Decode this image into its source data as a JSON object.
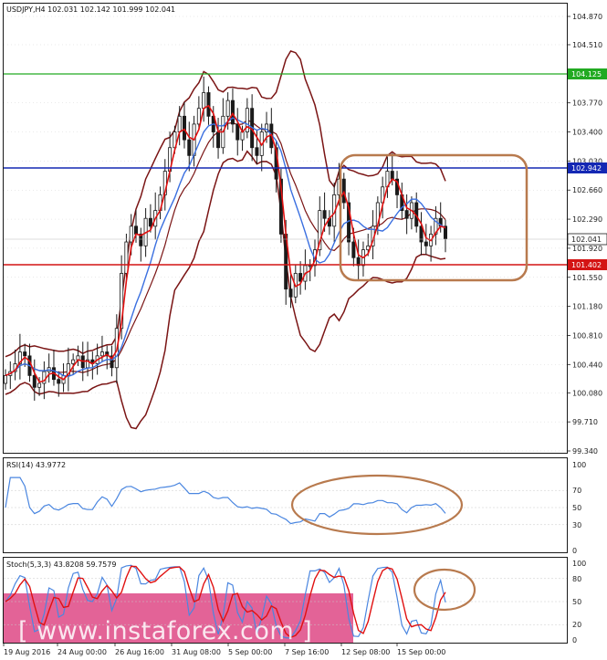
{
  "colors": {
    "frame": "#1a1a1a",
    "grid": "#c8c8c8",
    "bull": "#1a1a1a",
    "bear": "#1a1a1a",
    "boll": "#7a1414",
    "ma_fast": "#e01010",
    "ma_slow": "#3a6fe0",
    "line_green": "#22aa22",
    "line_blue": "#1428b4",
    "line_red": "#d41414",
    "annot": "#b87a4e",
    "rsi": "#4a86e0",
    "stoch_main": "#4a86e0",
    "stoch_signal": "#e01010",
    "wm_bg": "#e0528c"
  },
  "main_chart": {
    "title": "USDJPY,H4  102.031 102.142 101.999 102.041",
    "price_ticks": [
      "104.870",
      "104.510",
      "104.140",
      "103.770",
      "103.400",
      "103.030",
      "102.660",
      "102.290",
      "101.920",
      "101.550",
      "101.180",
      "100.810",
      "100.440",
      "100.080",
      "99.710",
      "99.340"
    ],
    "level_labels": {
      "green": "104.125",
      "blue": "102.942",
      "current": "102.041",
      "red": "101.402"
    }
  },
  "rsi_panel": {
    "title": "RSI(14) 43.9772",
    "ticks": [
      "100",
      "70",
      "50",
      "30",
      "0"
    ]
  },
  "stoch_panel": {
    "title": "Stoch(5,3,3) 43.8208 59.7579",
    "ticks": [
      "100",
      "80",
      "50",
      "20",
      "0"
    ]
  },
  "x_axis": {
    "labels": [
      "19 Aug 2016",
      "24 Aug 00:00",
      "26 Aug 16:00",
      "31 Aug 08:00",
      "5 Sep 00:00",
      "7 Sep 16:00",
      "12 Sep 08:00",
      "15 Sep 00:00"
    ]
  },
  "watermark": {
    "text": "[ www.instaforex.com ]"
  },
  "chart_data": {
    "type": "candlestick",
    "symbol": "USDJPY",
    "timeframe": "H4",
    "ylim": [
      99.34,
      104.87
    ],
    "horizontal_levels": [
      104.125,
      102.942,
      101.402
    ],
    "current_price": 102.041,
    "ohlc_last": {
      "open": 102.031,
      "high": 102.142,
      "low": 101.999,
      "close": 102.041
    },
    "indicators": {
      "rsi_14": 43.9772,
      "stoch_5_3_3": [
        43.8208,
        59.7579
      ]
    },
    "closes_approx": [
      100.3,
      100.35,
      100.45,
      100.6,
      100.55,
      100.3,
      100.15,
      100.2,
      100.35,
      100.4,
      100.25,
      100.2,
      100.3,
      100.45,
      100.5,
      100.55,
      100.4,
      100.5,
      100.45,
      100.55,
      100.6,
      100.55,
      100.4,
      100.9,
      101.6,
      102.0,
      102.2,
      102.1,
      101.95,
      102.3,
      102.2,
      102.4,
      102.6,
      102.9,
      103.2,
      103.4,
      103.6,
      103.3,
      103.1,
      103.5,
      103.7,
      103.9,
      103.6,
      103.4,
      103.2,
      103.6,
      103.8,
      103.5,
      103.3,
      103.4,
      103.7,
      103.2,
      103.1,
      103.4,
      103.5,
      103.2,
      102.8,
      102.1,
      101.4,
      101.3,
      101.6,
      101.5,
      101.7,
      101.7,
      101.9,
      102.4,
      102.3,
      102.2,
      102.6,
      102.8,
      102.5,
      102.0,
      101.8,
      101.7,
      101.9,
      101.95,
      102.2,
      102.5,
      102.7,
      102.9,
      102.8,
      102.6,
      102.4,
      102.3,
      102.5,
      102.2,
      102.0,
      101.95,
      102.1,
      102.3,
      102.2,
      102.04
    ]
  }
}
